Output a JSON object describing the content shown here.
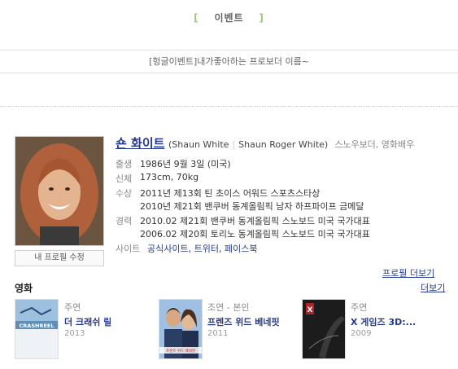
{
  "header": {
    "bracket_left": "[",
    "title": "이벤트",
    "bracket_right": "]"
  },
  "event_name": "[헝글이벤트]내가좋아하는 프로보더 이름~",
  "profile": {
    "name": "숀 화이트",
    "aka_1": "(Shaun White",
    "aka_2": "Shaun Roger White)",
    "job": "스노우보더, 영화배우",
    "edit_button": "내 프로필 수정",
    "rows": [
      {
        "label": "출생",
        "lines": [
          "1986년 9월 3일 (미국)"
        ]
      },
      {
        "label": "신체",
        "lines": [
          "173cm, 70kg"
        ]
      },
      {
        "label": "수상",
        "lines": [
          "2011년 제13회 틴 초이스 어워드 스포츠스타상",
          "2010년 제21회 밴쿠버 동계올림픽 남자 하프파이프 금메달"
        ]
      },
      {
        "label": "경력",
        "lines": [
          "2010.02 제21회 밴쿠버 동계올림픽 스노보드 미국 국가대표",
          "2006.02 제20회 토리노 동계올림픽 스노보드 미국 국가대표"
        ]
      }
    ],
    "site_label": "사이트",
    "sites": [
      "공식사이트",
      "트위터",
      "페이스북"
    ],
    "more_profile": "프로필 더보기"
  },
  "movies": {
    "section_title": "영화",
    "more": "더보기",
    "items": [
      {
        "role": "주연",
        "title": "더 크래쉬 릴",
        "year": "2013",
        "poster_text": "CRASHREEL"
      },
      {
        "role": "조연 - 본인",
        "title": "프렌즈 위드 베네핏",
        "year": "2011",
        "poster_text": "프렌즈 위드 베네핏"
      },
      {
        "role": "주연",
        "title": "X 게임즈 3D:...",
        "year": "2009",
        "poster_text": "X"
      }
    ]
  },
  "colors": {
    "link": "#243a90",
    "accent_bracket": "#9fc77a"
  }
}
